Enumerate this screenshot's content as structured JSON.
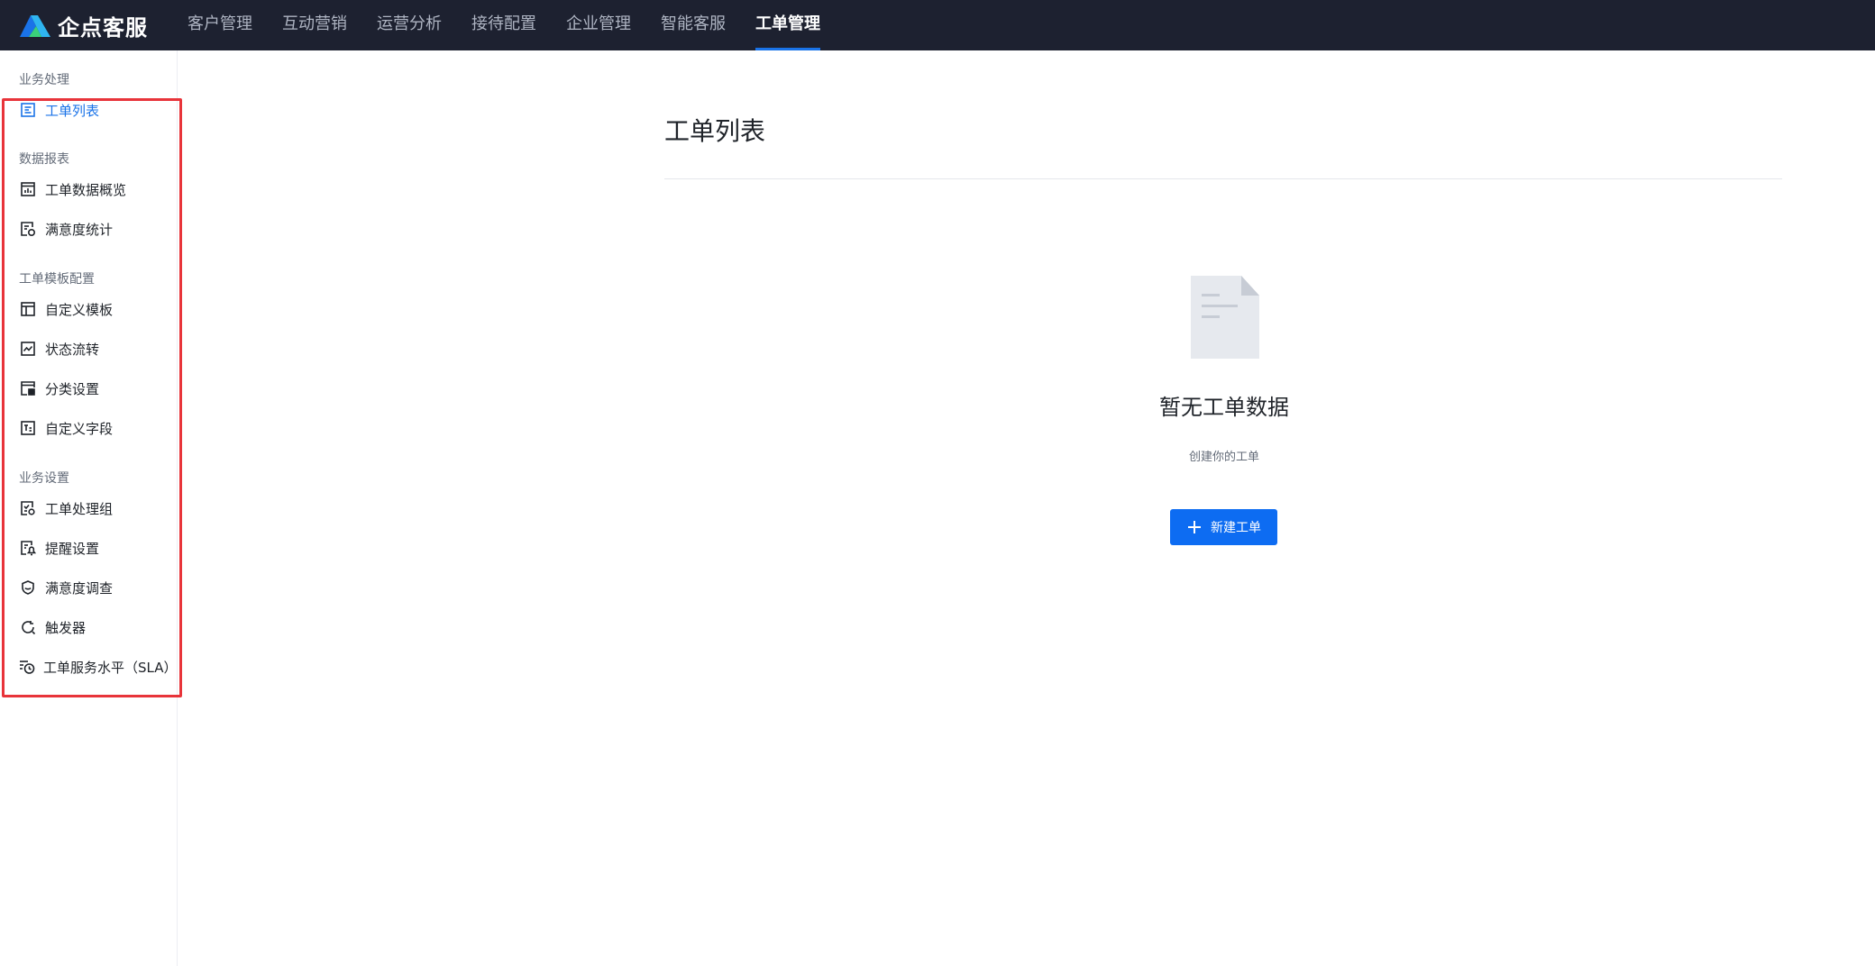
{
  "brand": {
    "name": "企点客服",
    "logo_icon": "qidian-logo-icon"
  },
  "nav": {
    "items": [
      {
        "label": "客户管理",
        "active": false
      },
      {
        "label": "互动营销",
        "active": false
      },
      {
        "label": "运营分析",
        "active": false
      },
      {
        "label": "接待配置",
        "active": false
      },
      {
        "label": "企业管理",
        "active": false
      },
      {
        "label": "智能客服",
        "active": false
      },
      {
        "label": "工单管理",
        "active": true
      }
    ]
  },
  "sidebar": {
    "groups": [
      {
        "title": "业务处理",
        "items": [
          {
            "label": "工单列表",
            "icon": "ticket-list-icon",
            "active": true
          }
        ]
      },
      {
        "title": "数据报表",
        "items": [
          {
            "label": "工单数据概览",
            "icon": "bar-chart-icon",
            "active": false
          },
          {
            "label": "满意度统计",
            "icon": "satisfaction-stats-icon",
            "active": false
          }
        ]
      },
      {
        "title": "工单模板配置",
        "items": [
          {
            "label": "自定义模板",
            "icon": "template-layout-icon",
            "active": false
          },
          {
            "label": "状态流转",
            "icon": "line-chart-icon",
            "active": false
          },
          {
            "label": "分类设置",
            "icon": "category-grid-icon",
            "active": false
          },
          {
            "label": "自定义字段",
            "icon": "text-field-icon",
            "active": false
          }
        ]
      },
      {
        "title": "业务设置",
        "items": [
          {
            "label": "工单处理组",
            "icon": "group-settings-icon",
            "active": false
          },
          {
            "label": "提醒设置",
            "icon": "reminder-icon",
            "active": false
          },
          {
            "label": "满意度调查",
            "icon": "survey-icon",
            "active": false
          },
          {
            "label": "触发器",
            "icon": "trigger-icon",
            "active": false
          },
          {
            "label": "工单服务水平（SLA）",
            "icon": "sla-clock-icon",
            "active": false
          }
        ]
      }
    ]
  },
  "main": {
    "title": "工单列表",
    "empty": {
      "icon": "empty-document-icon",
      "title": "暂无工单数据",
      "subtitle": "创建你的工单"
    },
    "new_button": {
      "label": "新建工单",
      "icon": "plus-icon"
    }
  },
  "colors": {
    "topbar_bg": "#1d2130",
    "accent": "#1a73e8",
    "button": "#0d6cf2",
    "highlight_border": "#e8343a"
  }
}
